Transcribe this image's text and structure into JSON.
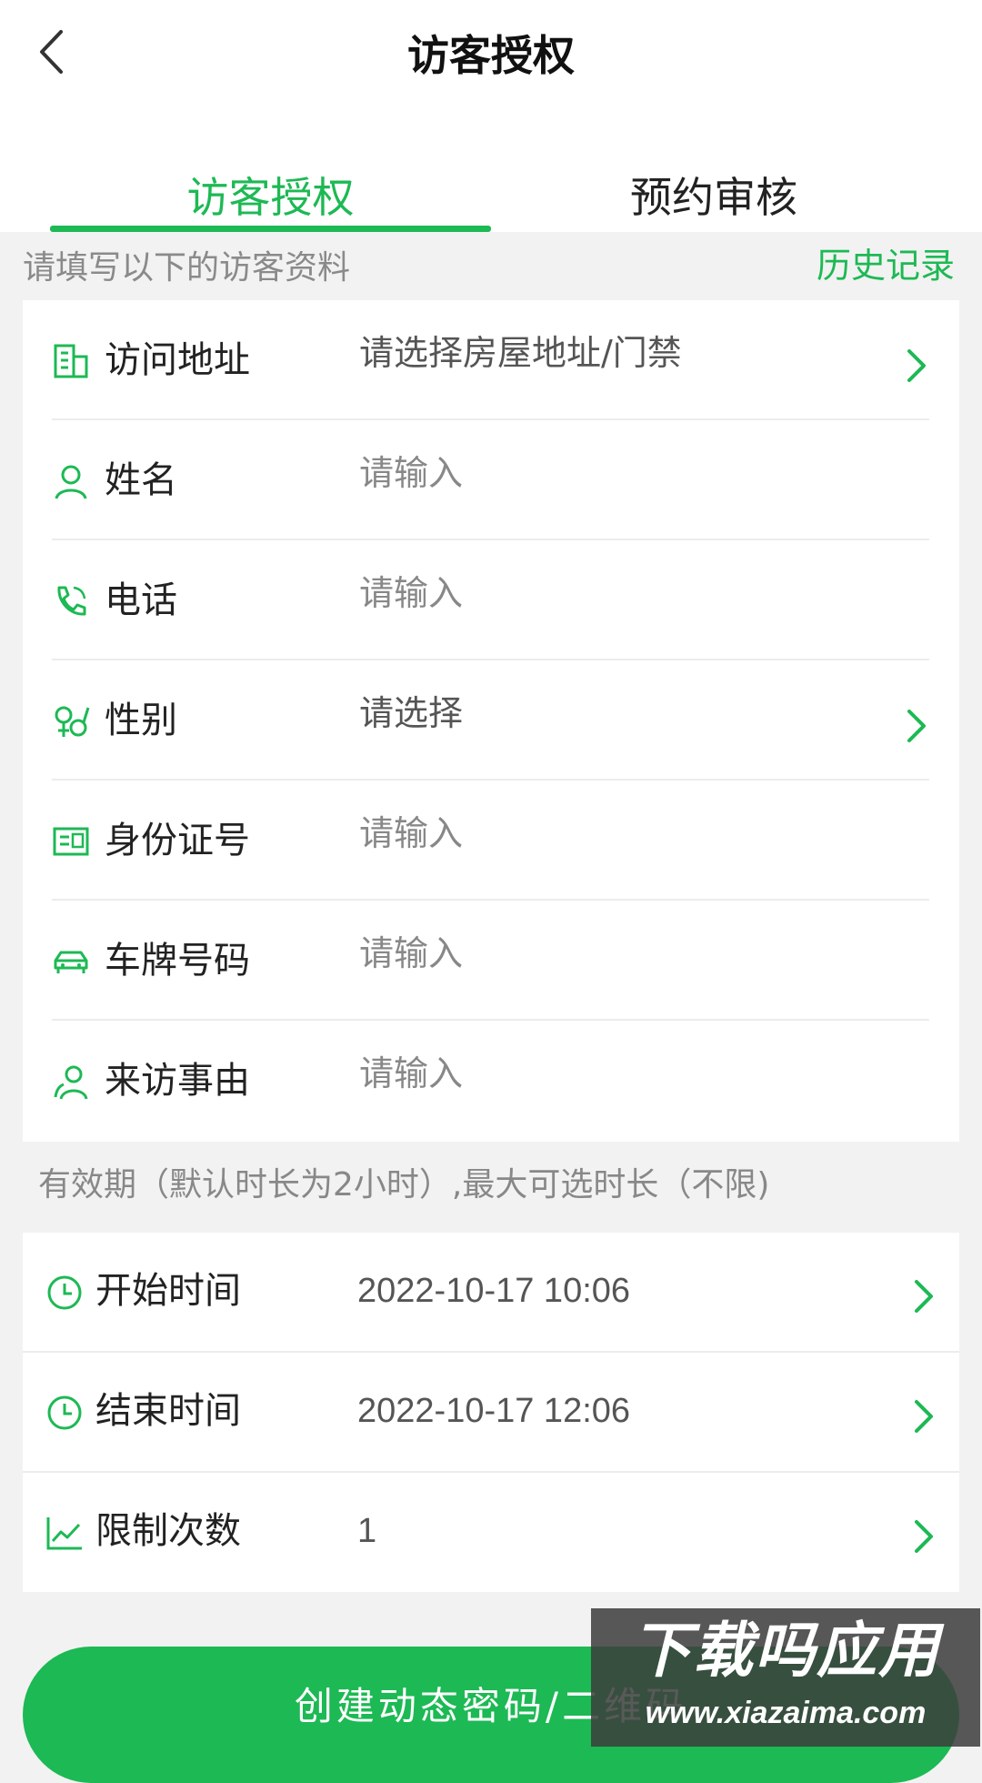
{
  "header": {
    "title": "访客授权",
    "back_icon": "chevron-left-icon"
  },
  "tabs": [
    {
      "label": "访客授权",
      "active": true
    },
    {
      "label": "预约审核",
      "active": false
    }
  ],
  "form_hint": "请填写以下的访客资料",
  "history_link": "历史记录",
  "fields": [
    {
      "icon": "building-icon",
      "label": "访问地址",
      "value": "请选择房屋地址/门禁",
      "has_chevron": true
    },
    {
      "icon": "person-icon",
      "label": "姓名",
      "placeholder": "请输入",
      "has_chevron": false
    },
    {
      "icon": "phone-icon",
      "label": "电话",
      "placeholder": "请输入",
      "has_chevron": false
    },
    {
      "icon": "gender-icon",
      "label": "性别",
      "value": "请选择",
      "has_chevron": true
    },
    {
      "icon": "id-card-icon",
      "label": "身份证号",
      "placeholder": "请输入",
      "has_chevron": false
    },
    {
      "icon": "car-icon",
      "label": "车牌号码",
      "placeholder": "请输入",
      "has_chevron": false
    },
    {
      "icon": "visitor-reason-icon",
      "label": "来访事由",
      "placeholder": "请输入",
      "has_chevron": false
    }
  ],
  "validity_note": "有效期（默认时长为2小时）,最大可选时长（不限)",
  "time_fields": [
    {
      "icon": "clock-icon",
      "label": "开始时间",
      "value": "2022-10-17 10:06"
    },
    {
      "icon": "clock-icon",
      "label": "结束时间",
      "value": "2022-10-17 12:06"
    },
    {
      "icon": "chart-icon",
      "label": "限制次数",
      "value": "1"
    }
  ],
  "submit_label": "创建动态密码/二维码",
  "watermark": {
    "big": "下载吗应用",
    "small": "www.xiazaima.com"
  },
  "colors": {
    "accent": "#1db954",
    "background": "#f2f2f2"
  }
}
